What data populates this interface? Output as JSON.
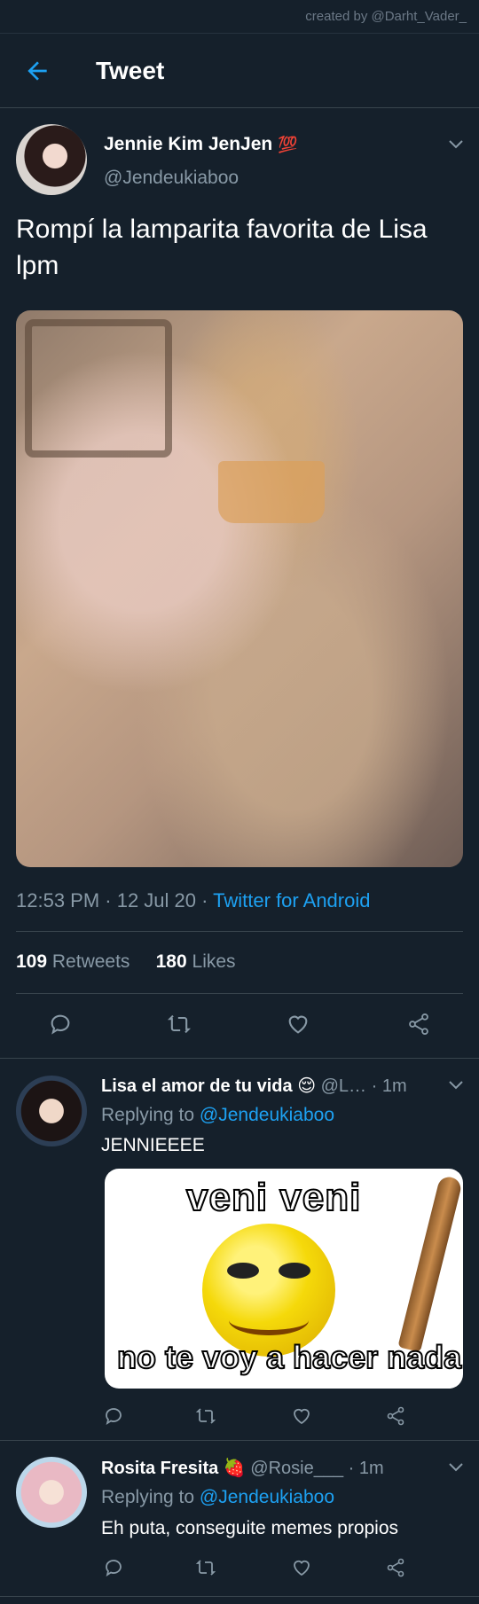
{
  "credit": "created by @Darht_Vader_",
  "header": {
    "title": "Tweet"
  },
  "tweet": {
    "author_name": "Jennie Kim JenJen",
    "author_badge": "💯",
    "author_handle": "@Jendeukiaboo",
    "text": "Rompí la lamparita favorita de Lisa lpm",
    "time": "12:53 PM · 12 Jul 20 · ",
    "source": "Twitter for Android",
    "retweets_count": "109",
    "retweets_label": "Retweets",
    "likes_count": "180",
    "likes_label": "Likes"
  },
  "replies": [
    {
      "name": "Lisa el amor de tu vida",
      "emoji": "😌",
      "handle": "@L…",
      "time": "· 1m",
      "replying_prefix": "Replying to ",
      "replying_to": "@Jendeukiaboo",
      "text": "JENNIEEEE",
      "meme_top": "veni veni",
      "meme_bottom": "no te voy a hacer nada"
    },
    {
      "name": "Rosita Fresita",
      "emoji": "🍓",
      "handle": "@Rosie___",
      "time": "· 1m",
      "replying_prefix": "Replying to ",
      "replying_to": "@Jendeukiaboo",
      "text": "Eh puta, conseguite memes propios"
    }
  ],
  "icons": [
    "back-arrow-icon",
    "chevron-down-icon",
    "reply-icon",
    "retweet-icon",
    "like-icon",
    "share-icon"
  ],
  "colors": {
    "background": "#15202b",
    "accent": "#1da1f2",
    "secondary_text": "#8899a6",
    "divider": "#38444d"
  }
}
